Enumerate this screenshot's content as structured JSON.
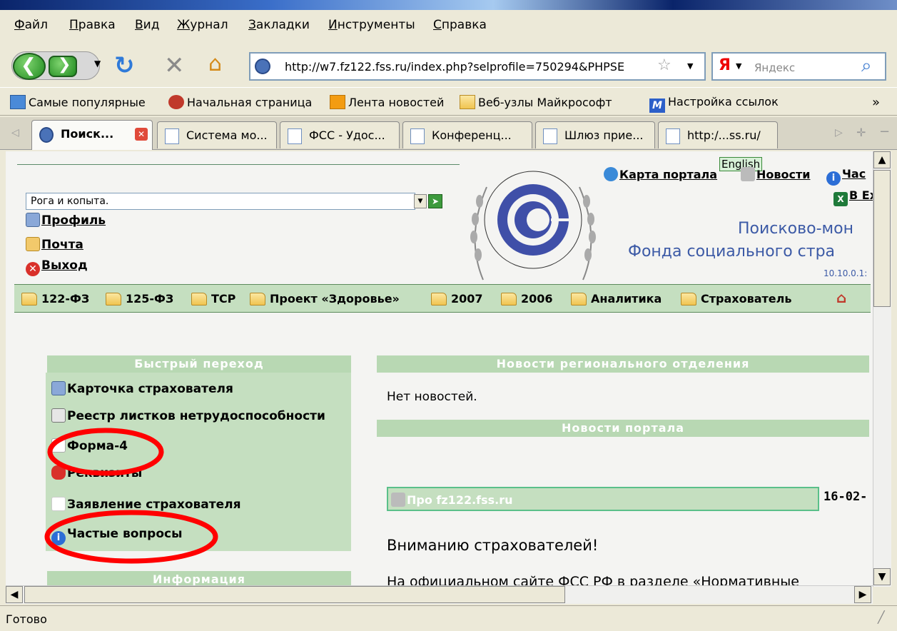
{
  "menu": [
    "Файл",
    "Правка",
    "Вид",
    "Журнал",
    "Закладки",
    "Инструменты",
    "Справка"
  ],
  "nav": {
    "url": "http://w7.fz122.fss.ru/index.php?selprofile=750294&PHPSE",
    "search_engine": "Я",
    "search_placeholder": "Яндекс"
  },
  "bookmarks": [
    "Самые популярные",
    "Начальная страница",
    "Лента новостей",
    "Веб-узлы Майкрософт",
    "Настройка ссылок"
  ],
  "bookmarks_more": "»",
  "tabs": [
    "Поиск...",
    "Система мо...",
    "ФСС - Удос...",
    "Конференц...",
    "Шлюз прие...",
    "http:/...ss.ru/"
  ],
  "page": {
    "english_label": "English",
    "search_value": "Рога и копыта.",
    "profile_link": "Профиль",
    "mail_link": "Почта",
    "exit_link": "Выход",
    "portal_map": "Карта портала",
    "news_link": "Новости",
    "faq_partial": "Час",
    "excel_partial": "В Ех",
    "title_line1": "Поисково-мон",
    "title_line2": "Фонда социального стра",
    "version": "10.10.0.1:",
    "nav_items": [
      "122-ФЗ",
      "125-ФЗ",
      "ТСР",
      "Проект «Здоровье»",
      "2007",
      "2006",
      "Аналитика",
      "Страхователь"
    ],
    "quick_nav_header": "Быстрый переход",
    "quick_links": [
      "Карточка страхователя",
      "Реестр листков нетрудоспособности",
      "Форма-4",
      "Реквизиты",
      "Заявление страхователя",
      "Частые вопросы"
    ],
    "info_header": "Информация",
    "regional_news_header": "Новости регионального отделения",
    "no_news": "Нет новостей.",
    "portal_news_header": "Новости портала",
    "news_item_title": "Про fz122.fss.ru",
    "news_item_date": "16-02-",
    "attention": "Вниманию страхователей!",
    "body_partial": "На официальном сайте ФСС РФ в разделе «Нормативные"
  },
  "status": "Готово",
  "colors": {
    "panel_green": "#c5dfc0",
    "header_green": "#b8d8b3",
    "annotation_red": "#ff0000",
    "title_blue": "#3c5aa6"
  }
}
